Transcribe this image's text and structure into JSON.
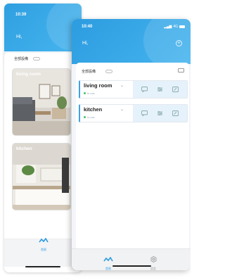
{
  "back_screen": {
    "time": "10:39",
    "greeting": "Hi,",
    "tabs_label": "全部設備",
    "rooms": [
      {
        "label": "living room"
      },
      {
        "label": "kitchen"
      }
    ],
    "nav_home_label": "首頁"
  },
  "front_screen": {
    "status": {
      "time": "10:40",
      "signal": "4G"
    },
    "greeting": "Hi,",
    "tabs_label": "全部設備",
    "rooms": [
      {
        "name": "living room",
        "status": "in use"
      },
      {
        "name": "kitchen",
        "status": "in use"
      }
    ],
    "nav": {
      "home_label": "首頁",
      "settings_label": "設定"
    }
  },
  "colors": {
    "accent": "#2d9ce0",
    "card_action_bg": "#e6f2fb",
    "online_dot": "#46c36a"
  }
}
